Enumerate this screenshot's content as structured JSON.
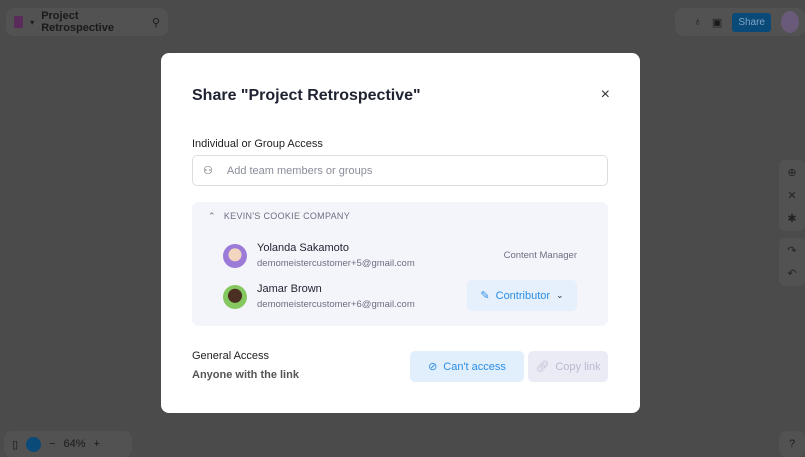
{
  "topbar": {
    "title": "Project Retrospective",
    "share_label": "Share"
  },
  "zoom": {
    "level": "64%",
    "minus": "−",
    "plus": "+"
  },
  "modal": {
    "title": "Share \"Project Retrospective\"",
    "close": "×",
    "access_label": "Individual or Group Access",
    "input_placeholder": "Add team members or groups",
    "group": {
      "name": "KEVIN'S COOKIE COMPANY",
      "members": [
        {
          "name": "Yolanda Sakamoto",
          "email": "demomeistercustomer+5@gmail.com",
          "role": "Content Manager"
        },
        {
          "name": "Jamar Brown",
          "email": "demomeistercustomer+6@gmail.com",
          "role": "Contributor"
        }
      ]
    },
    "general_access": "General Access",
    "general_access_value": "Anyone with the link",
    "cant_access": "Can't access",
    "copy_link": "Copy link"
  }
}
